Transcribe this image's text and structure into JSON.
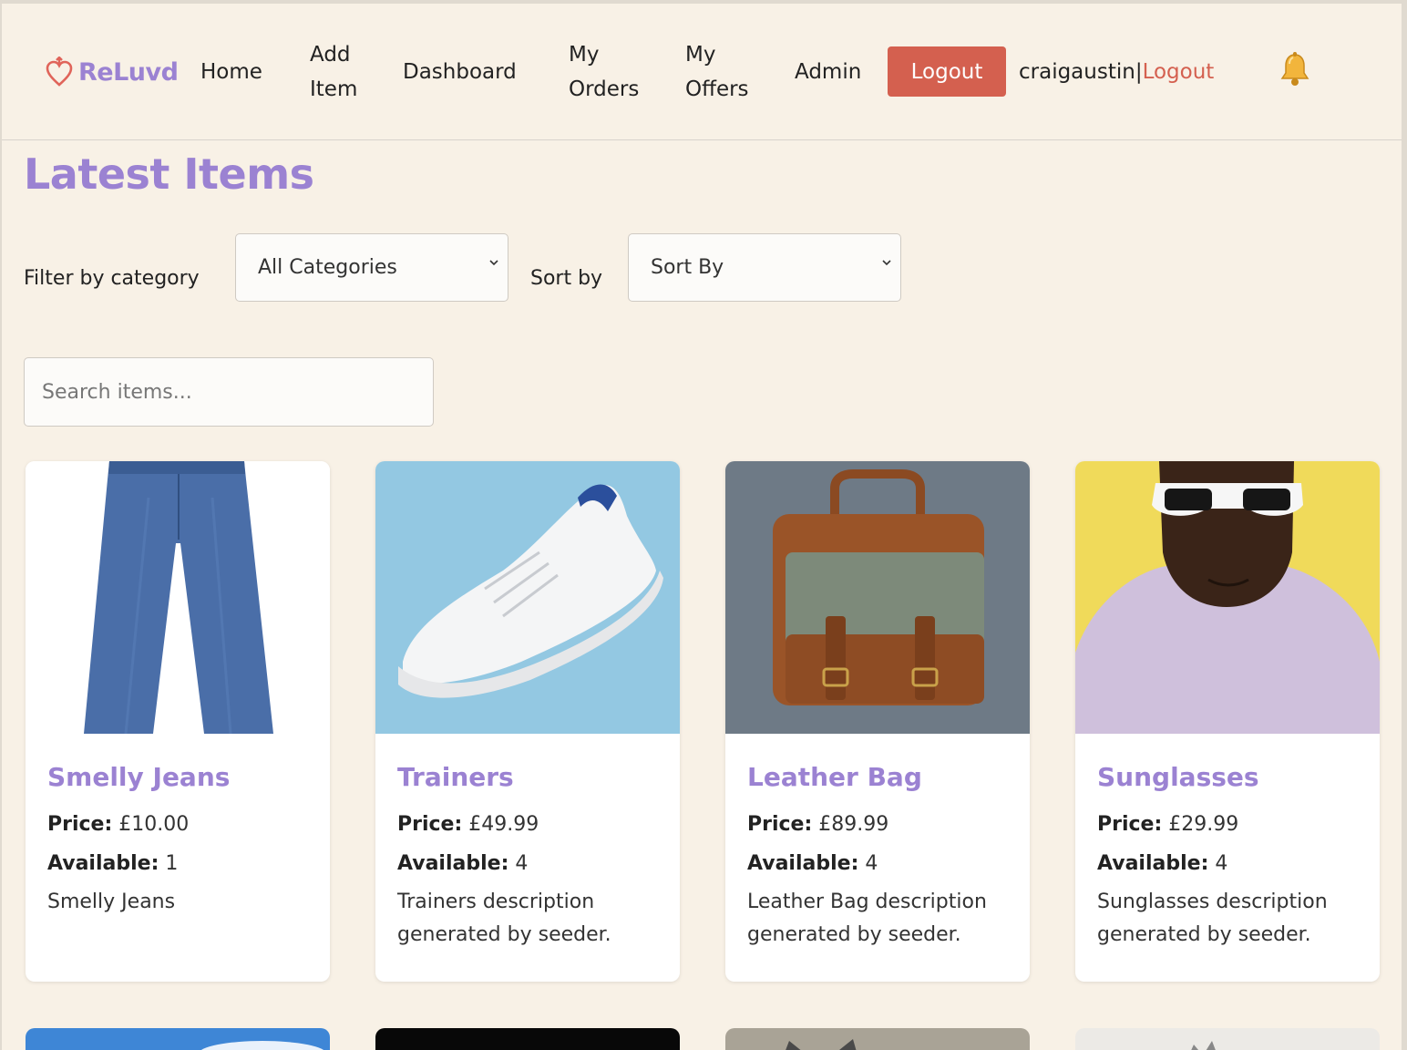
{
  "nav": {
    "brand": "ReLuvd",
    "home": "Home",
    "add_item_1": "Add",
    "add_item_2": "Item",
    "dashboard": "Dashboard",
    "orders_1": "My",
    "orders_2": "Orders",
    "offers_1": "My",
    "offers_2": "Offers",
    "admin": "Admin",
    "logout_button": "Logout",
    "username": "craigaustin",
    "separator": "|",
    "logout_link": "Logout",
    "bell_icon": "bell-icon"
  },
  "main": {
    "title": "Latest Items",
    "filter_label": "Filter by category",
    "category_selected": "All Categories",
    "sort_label": "Sort by",
    "sort_selected": "Sort By",
    "search_placeholder": "Search items..."
  },
  "labels": {
    "price": "Price:",
    "available": "Available:"
  },
  "items": [
    {
      "name": "Smelly Jeans",
      "price": "£10.00",
      "available": "1",
      "description": "Smelly Jeans"
    },
    {
      "name": "Trainers",
      "price": "£49.99",
      "available": "4",
      "description": "Trainers description generated by seeder."
    },
    {
      "name": "Leather Bag",
      "price": "£89.99",
      "available": "4",
      "description": "Leather Bag description generated by seeder."
    },
    {
      "name": "Sunglasses",
      "price": "£29.99",
      "available": "4",
      "description": "Sunglasses description generated by seeder."
    }
  ],
  "colors": {
    "brand_purple": "#9b82d2",
    "logout_red": "#d4604f",
    "background": "#f8f1e6"
  }
}
